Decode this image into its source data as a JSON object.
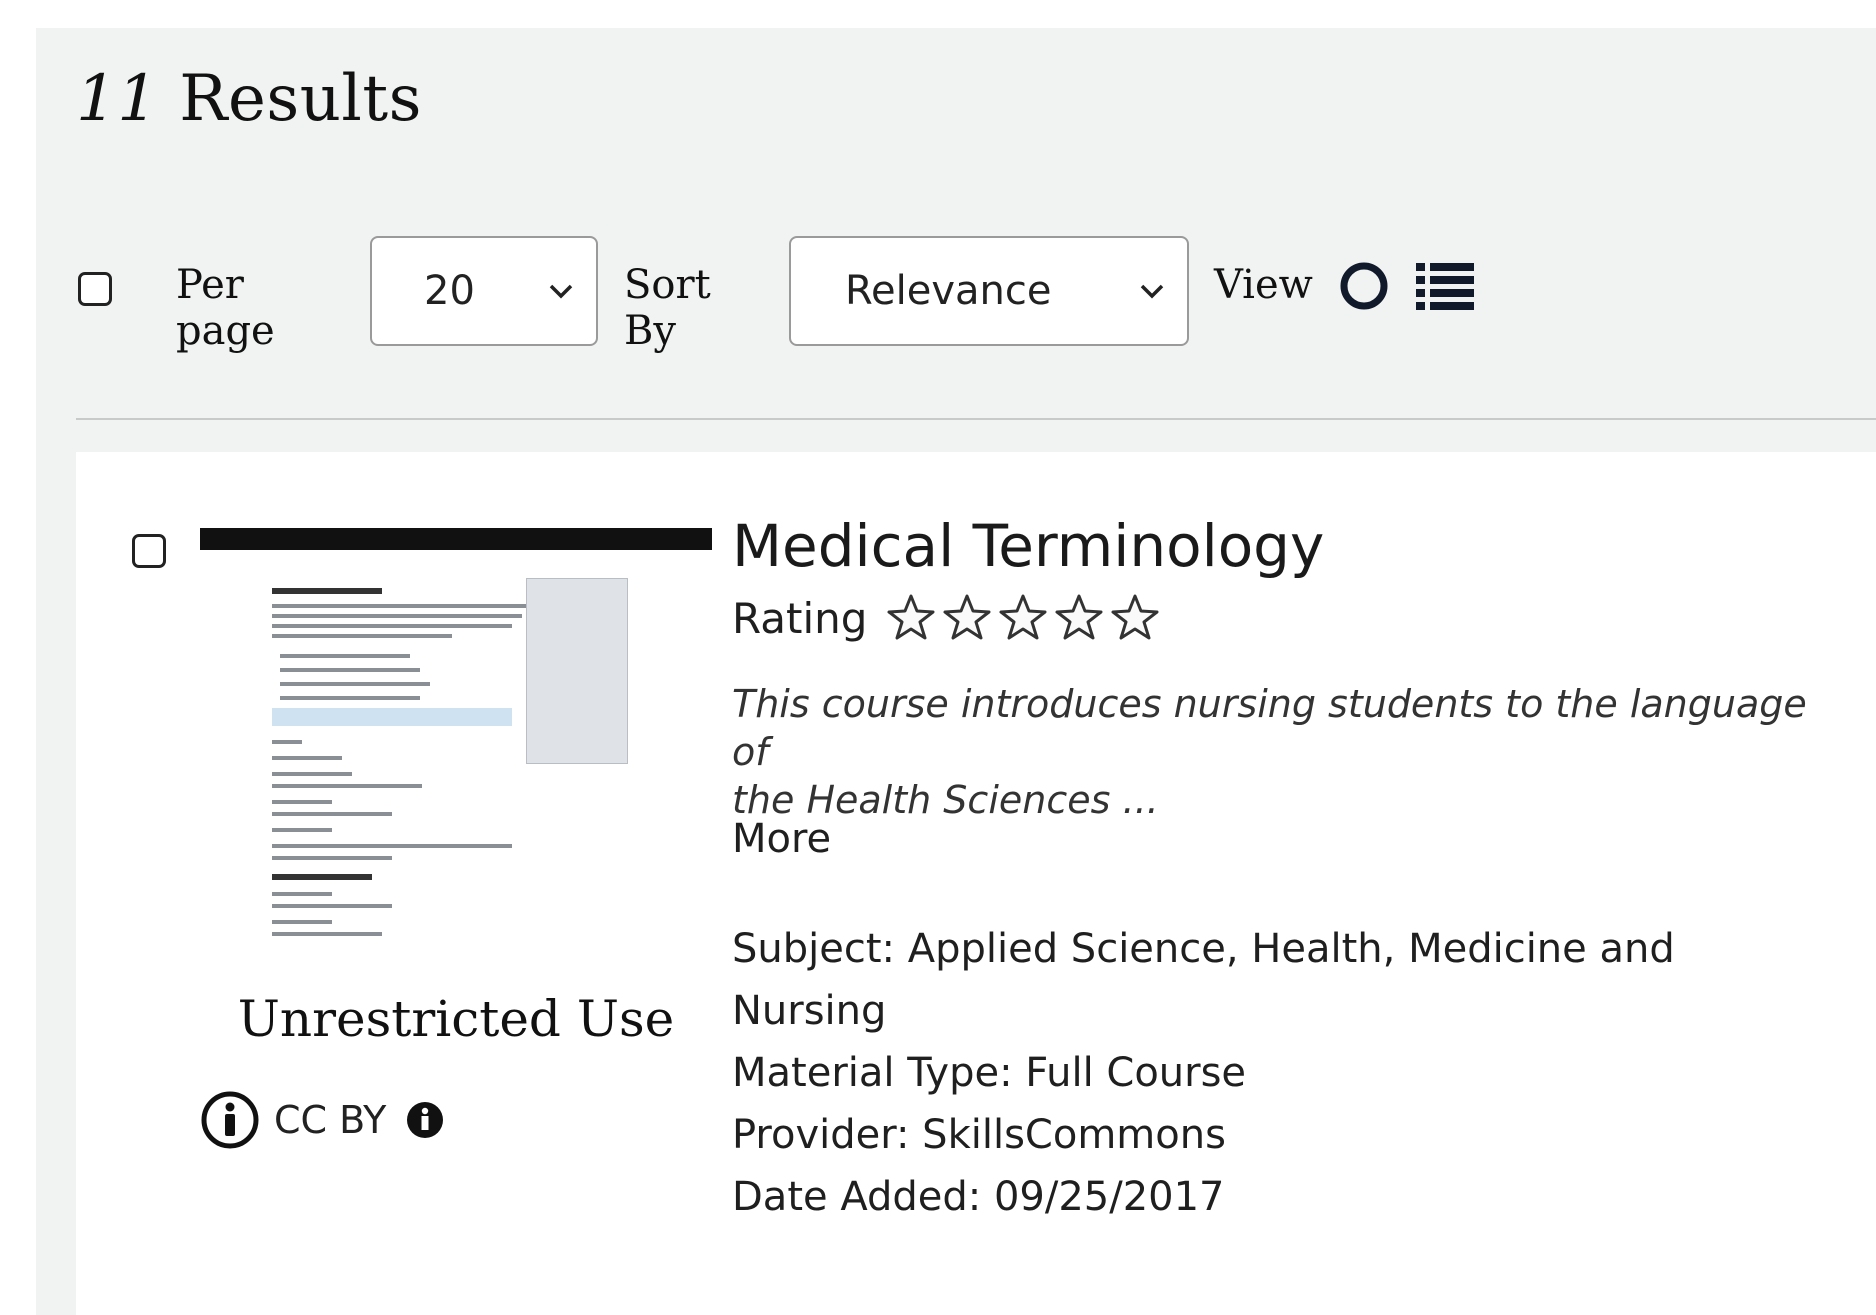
{
  "header": {
    "count": "11",
    "label": "Results"
  },
  "toolbar": {
    "per_page_label": "Per page",
    "per_page_value": "20",
    "sort_label": "Sort By",
    "sort_value": "Relevance",
    "view_label": "View"
  },
  "result": {
    "title": "Medical Terminology",
    "rating_label": "Rating",
    "rating_stars": 0,
    "rating_max": 5,
    "description_line1": "This course introduces nursing students to the language of",
    "description_line2": "the Health Sciences ...",
    "more_label": "More",
    "use_heading": "Unrestricted Use",
    "license": "CC BY",
    "subject_line1": "Subject: Applied Science, Health, Medicine and",
    "subject_line2": "Nursing",
    "material_type": "Material Type: Full Course",
    "provider": "Provider: SkillsCommons",
    "date_added": "Date Added: 09/25/2017"
  },
  "colors": {
    "panel_bg": "#f1f2f2",
    "card_bg": "#ffffff",
    "icon_dark": "#111a2b"
  }
}
